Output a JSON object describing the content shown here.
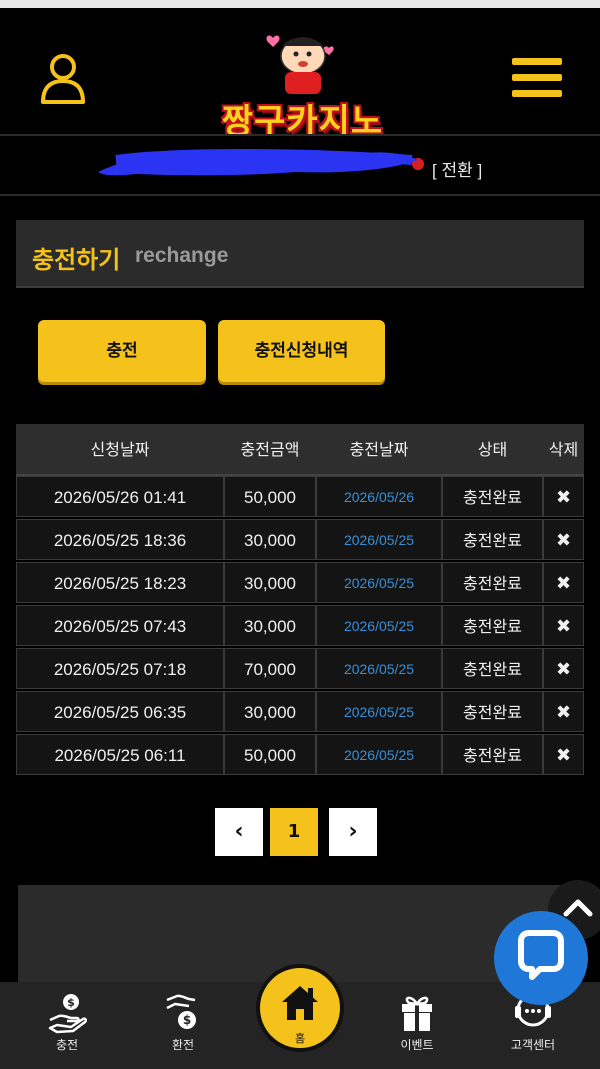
{
  "header": {
    "logo_text": "짱구카지노",
    "icons": {
      "user": "user-icon",
      "menu": "hamburger-menu-icon"
    },
    "accent_color": "#f4c21a"
  },
  "userbar": {
    "switch_label": "[ 전환 ]"
  },
  "section": {
    "title": "충전하기",
    "subtitle": "rechange"
  },
  "buttons": {
    "charge": "충전",
    "history": "충전신청내역"
  },
  "table": {
    "headers": [
      "신청날짜",
      "충전금액",
      "충전날짜",
      "상태",
      "삭제"
    ],
    "rows": [
      {
        "request_date": "2026/05/26 01:41",
        "amount": "50,000",
        "charge_date": "2026/05/26",
        "status": "충전완료",
        "delete": "✖"
      },
      {
        "request_date": "2026/05/25 18:36",
        "amount": "30,000",
        "charge_date": "2026/05/25",
        "status": "충전완료",
        "delete": "✖"
      },
      {
        "request_date": "2026/05/25 18:23",
        "amount": "30,000",
        "charge_date": "2026/05/25",
        "status": "충전완료",
        "delete": "✖"
      },
      {
        "request_date": "2026/05/25 07:43",
        "amount": "30,000",
        "charge_date": "2026/05/25",
        "status": "충전완료",
        "delete": "✖"
      },
      {
        "request_date": "2026/05/25 07:18",
        "amount": "70,000",
        "charge_date": "2026/05/25",
        "status": "충전완료",
        "delete": "✖"
      },
      {
        "request_date": "2026/05/25 06:35",
        "amount": "30,000",
        "charge_date": "2026/05/25",
        "status": "충전완료",
        "delete": "✖"
      },
      {
        "request_date": "2026/05/25 06:11",
        "amount": "50,000",
        "charge_date": "2026/05/25",
        "status": "충전완료",
        "delete": "✖"
      }
    ]
  },
  "pagination": {
    "prev": "‹",
    "current": "1",
    "next": "›"
  },
  "bottom_nav": {
    "items": [
      {
        "label": "충전",
        "icon": "hand-coin-icon"
      },
      {
        "label": "환전",
        "icon": "hand-coin-exchange-icon"
      },
      {
        "label": "홈",
        "icon": "home-icon"
      },
      {
        "label": "이벤트",
        "icon": "gift-icon"
      },
      {
        "label": "고객센터",
        "icon": "headset-icon"
      }
    ]
  },
  "floating": {
    "scroll_top_icon": "chevron-up-icon",
    "chat_icon": "chat-bubble-icon",
    "chat_color": "#1f78d8"
  }
}
